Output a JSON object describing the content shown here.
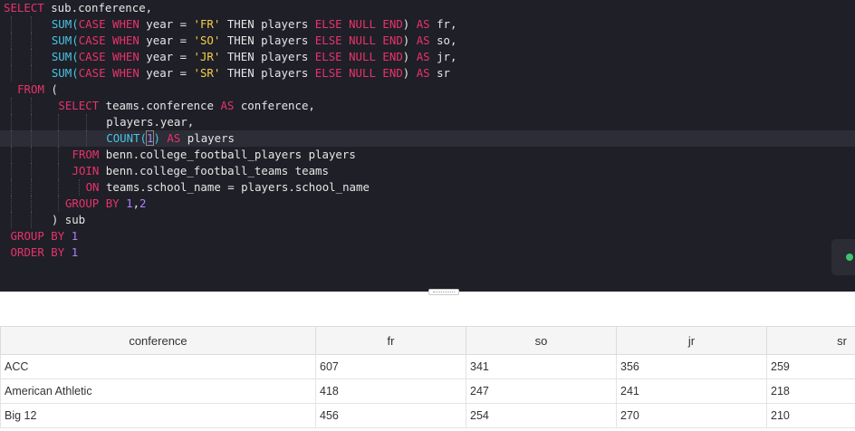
{
  "editor": {
    "lines": [
      [
        [
          "kw",
          "SELECT"
        ],
        [
          "p",
          " sub.conference,"
        ]
      ],
      [
        [
          "fn",
          "SUM("
        ],
        [
          "kw",
          "CASE WHEN"
        ],
        [
          "p",
          " year = "
        ],
        [
          "str",
          "'FR'"
        ],
        [
          "p",
          " THEN players "
        ],
        [
          "kw",
          "ELSE NULL END"
        ],
        [
          "p",
          ") "
        ],
        [
          "kw",
          "AS"
        ],
        [
          "p",
          " fr,"
        ]
      ],
      [
        [
          "fn",
          "SUM("
        ],
        [
          "kw",
          "CASE WHEN"
        ],
        [
          "p",
          " year = "
        ],
        [
          "str",
          "'SO'"
        ],
        [
          "p",
          " THEN players "
        ],
        [
          "kw",
          "ELSE NULL END"
        ],
        [
          "p",
          ") "
        ],
        [
          "kw",
          "AS"
        ],
        [
          "p",
          " so,"
        ]
      ],
      [
        [
          "fn",
          "SUM("
        ],
        [
          "kw",
          "CASE WHEN"
        ],
        [
          "p",
          " year = "
        ],
        [
          "str",
          "'JR'"
        ],
        [
          "p",
          " THEN players "
        ],
        [
          "kw",
          "ELSE NULL END"
        ],
        [
          "p",
          ") "
        ],
        [
          "kw",
          "AS"
        ],
        [
          "p",
          " jr,"
        ]
      ],
      [
        [
          "fn",
          "SUM("
        ],
        [
          "kw",
          "CASE WHEN"
        ],
        [
          "p",
          " year = "
        ],
        [
          "str",
          "'SR'"
        ],
        [
          "p",
          " THEN players "
        ],
        [
          "kw",
          "ELSE NULL END"
        ],
        [
          "p",
          ") "
        ],
        [
          "kw",
          "AS"
        ],
        [
          "p",
          " sr"
        ]
      ],
      [
        [
          "kw",
          "FROM"
        ],
        [
          "p",
          " ("
        ]
      ],
      [
        [
          "kw",
          "SELECT"
        ],
        [
          "p",
          " teams.conference "
        ],
        [
          "kw",
          "AS"
        ],
        [
          "p",
          " conference,"
        ]
      ],
      [
        [
          "p",
          "players.year,"
        ]
      ],
      [
        [
          "fn",
          "COUNT("
        ],
        [
          "num",
          "1"
        ],
        [
          "fn",
          ")"
        ],
        [
          "p",
          " "
        ],
        [
          "kw",
          "AS"
        ],
        [
          "p",
          " players"
        ]
      ],
      [
        [
          "kw",
          "FROM"
        ],
        [
          "p",
          " benn.college_football_players players"
        ]
      ],
      [
        [
          "kw",
          "JOIN"
        ],
        [
          "p",
          " benn.college_football_teams teams"
        ]
      ],
      [
        [
          "kw",
          "ON"
        ],
        [
          "p",
          " teams.school_name = players.school_name"
        ]
      ],
      [
        [
          "kw",
          "GROUP BY"
        ],
        [
          "p",
          " "
        ],
        [
          "num",
          "1"
        ],
        [
          "p",
          ","
        ],
        [
          "num",
          "2"
        ]
      ],
      [
        [
          "p",
          ") sub"
        ]
      ],
      [
        [
          "kw",
          "GROUP BY"
        ],
        [
          "p",
          " "
        ],
        [
          "num",
          "1"
        ]
      ],
      [
        [
          "kw",
          "ORDER BY"
        ],
        [
          "p",
          " "
        ],
        [
          "num",
          "1"
        ]
      ]
    ]
  },
  "results": {
    "columns": [
      "conference",
      "fr",
      "so",
      "jr",
      "sr"
    ],
    "rows": [
      [
        "ACC",
        "607",
        "341",
        "356",
        "259"
      ],
      [
        "American Athletic",
        "418",
        "247",
        "241",
        "218"
      ],
      [
        "Big 12",
        "456",
        "254",
        "270",
        "210"
      ]
    ]
  },
  "colors": {
    "editor_bg": "#1f1f27",
    "keyword": "#e8336b",
    "function": "#48c6e6",
    "string": "#f2d24a",
    "number": "#ae81ff",
    "status_ok": "#3ec46d"
  }
}
